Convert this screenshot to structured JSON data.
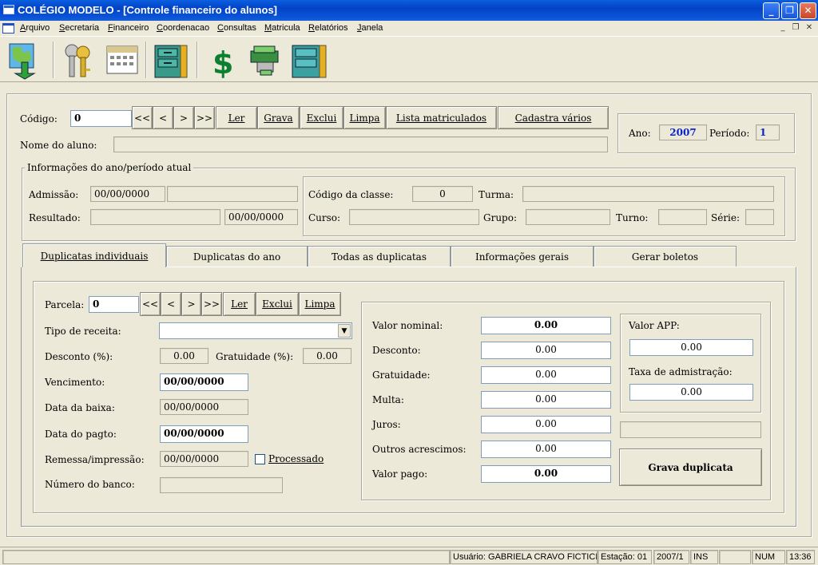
{
  "window": {
    "title": "COLÉGIO MODELO - [Controle financeiro do alunos]"
  },
  "menu": {
    "items": [
      "Arquivo",
      "Secretaria",
      "Financeiro",
      "Coordenacao",
      "Consultas",
      "Matricula",
      "Relatórios",
      "Janela"
    ]
  },
  "toolbar": {
    "icons": [
      "map-export-icon",
      "keys-icon",
      "calendar-icon",
      "filing-cabinet-icon",
      "dollar-icon",
      "money-printer-icon",
      "archive-cabinet-icon"
    ]
  },
  "header": {
    "codigo_label": "Código:",
    "codigo_value": "0",
    "nav": [
      "<<",
      "<",
      ">",
      ">>"
    ],
    "buttons": {
      "ler": "Ler",
      "grava": "Grava",
      "exclui": "Exclui",
      "limpa": "Limpa",
      "lista": "Lista matriculados",
      "cadastra": "Cadastra vários"
    },
    "nome_label": "Nome do aluno:",
    "nome_value": "",
    "ano_label": "Ano:",
    "ano_value": "2007",
    "periodo_label": "Período:",
    "periodo_value": "1"
  },
  "info": {
    "caption": "Informações do ano/período atual",
    "admissao_label": "Admissão:",
    "admissao_value": "00/00/0000",
    "resultado_label": "Resultado:",
    "resultado_date": "00/00/0000",
    "codigo_classe_label": "Código da classe:",
    "codigo_classe_value": "0",
    "turma_label": "Turma:",
    "curso_label": "Curso:",
    "grupo_label": "Grupo:",
    "turno_label": "Turno:",
    "serie_label": "Série:"
  },
  "tabs": [
    "Duplicatas individuais",
    "Duplicatas do ano",
    "Todas as duplicatas",
    "Informações gerais",
    "Gerar boletos"
  ],
  "duplicata": {
    "parcela_label": "Parcela:",
    "parcela_value": "0",
    "nav": [
      "<<",
      "<",
      ">",
      ">>"
    ],
    "buttons": {
      "ler": "Ler",
      "exclui": "Exclui",
      "limpa": "Limpa"
    },
    "tipo_label": "Tipo de receita:",
    "tipo_value": "",
    "desconto_label": "Desconto (%):",
    "desconto_value": "0.00",
    "gratuidade_label": "Gratuidade (%):",
    "gratuidade_value": "0.00",
    "vencimento_label": "Vencimento:",
    "vencimento_value": "00/00/0000",
    "baixa_label": "Data da baixa:",
    "baixa_value": "00/00/0000",
    "pagto_label": "Data do pagto:",
    "pagto_value": "00/00/0000",
    "remessa_label": "Remessa/impressão:",
    "remessa_value": "00/00/0000",
    "processado_label": "Processado",
    "banco_label": "Número do banco:",
    "banco_value": ""
  },
  "valores": {
    "nominal_label": "Valor nominal:",
    "nominal_value": "0.00",
    "desconto_label": "Desconto:",
    "desconto_value": "0.00",
    "gratuidade_label": "Gratuidade:",
    "gratuidade_value": "0.00",
    "multa_label": "Multa:",
    "multa_value": "0.00",
    "juros_label": "Juros:",
    "juros_value": "0.00",
    "outros_label": "Outros acrescimos:",
    "outros_value": "0.00",
    "pago_label": "Valor pago:",
    "pago_value": "0.00",
    "app_label": "Valor APP:",
    "app_value": "0.00",
    "taxa_label": "Taxa de admistração:",
    "taxa_value": "0.00",
    "grava_label": "Grava duplicata"
  },
  "status": {
    "usuario": "Usuário: GABRIELA CRAVO FICTICIO",
    "estacao": "Estação: 01",
    "periodo": "2007/1",
    "ins": "INS",
    "num": "NUM",
    "hora": "13:36"
  }
}
